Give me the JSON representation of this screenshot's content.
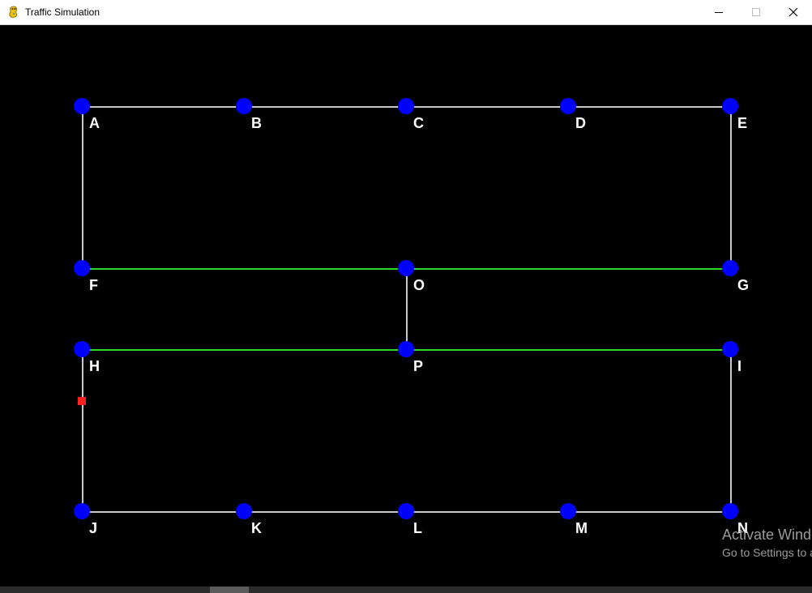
{
  "window": {
    "title": "Traffic Simulation",
    "controls": {
      "minimize": "minimize",
      "maximize": "maximize",
      "close": "close"
    }
  },
  "simulation": {
    "colors": {
      "background": "#000000",
      "node": "#0000ff",
      "road": "#c8c8c8",
      "green_road": "#2ed62e",
      "vehicle": "#ff2020",
      "label": "#ffffff"
    },
    "nodes": [
      {
        "id": "A",
        "label": "A"
      },
      {
        "id": "B",
        "label": "B"
      },
      {
        "id": "C",
        "label": "C"
      },
      {
        "id": "D",
        "label": "D"
      },
      {
        "id": "E",
        "label": "E"
      },
      {
        "id": "F",
        "label": "F"
      },
      {
        "id": "O",
        "label": "O"
      },
      {
        "id": "G",
        "label": "G"
      },
      {
        "id": "H",
        "label": "H"
      },
      {
        "id": "P",
        "label": "P"
      },
      {
        "id": "I",
        "label": "I"
      },
      {
        "id": "J",
        "label": "J"
      },
      {
        "id": "K",
        "label": "K"
      },
      {
        "id": "L",
        "label": "L"
      },
      {
        "id": "M",
        "label": "M"
      },
      {
        "id": "N",
        "label": "N"
      }
    ],
    "edges": [
      {
        "from": "A",
        "to": "B",
        "state": "normal"
      },
      {
        "from": "B",
        "to": "C",
        "state": "normal"
      },
      {
        "from": "C",
        "to": "D",
        "state": "normal"
      },
      {
        "from": "D",
        "to": "E",
        "state": "normal"
      },
      {
        "from": "A",
        "to": "F",
        "state": "normal"
      },
      {
        "from": "E",
        "to": "G",
        "state": "normal"
      },
      {
        "from": "F",
        "to": "O",
        "state": "green"
      },
      {
        "from": "O",
        "to": "G",
        "state": "green"
      },
      {
        "from": "O",
        "to": "P",
        "state": "normal"
      },
      {
        "from": "H",
        "to": "P",
        "state": "green"
      },
      {
        "from": "P",
        "to": "I",
        "state": "green"
      },
      {
        "from": "H",
        "to": "J",
        "state": "normal"
      },
      {
        "from": "I",
        "to": "N",
        "state": "normal"
      },
      {
        "from": "J",
        "to": "K",
        "state": "normal"
      },
      {
        "from": "K",
        "to": "L",
        "state": "normal"
      },
      {
        "from": "L",
        "to": "M",
        "state": "normal"
      },
      {
        "from": "M",
        "to": "N",
        "state": "normal"
      }
    ],
    "vehicles": [
      {
        "id": "car-1",
        "edge_from": "H",
        "edge_to": "J",
        "progress": 0.32
      }
    ]
  },
  "watermark": {
    "line1": "Activate Windows",
    "line2": "Go to Settings to activate Windows."
  }
}
